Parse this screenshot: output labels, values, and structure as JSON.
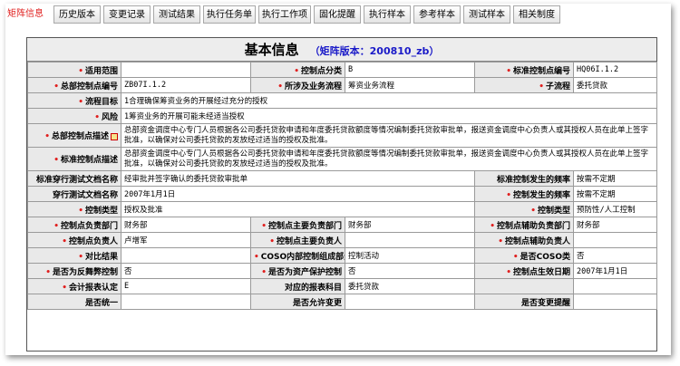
{
  "tabs": [
    "矩阵信息",
    "历史版本",
    "变更记录",
    "测试结果",
    "执行任务单",
    "执行工作项",
    "固化提醒",
    "执行样本",
    "参考样本",
    "测试样本",
    "相关制度"
  ],
  "title": "基本信息",
  "matrix_version": "（矩阵版本：200810_zb）",
  "fields": {
    "applicable_scope": {
      "label": "适用范围",
      "value": ""
    },
    "control_category": {
      "label": "控制点分类",
      "value": "B"
    },
    "std_control_code": {
      "label": "标准控制点编号",
      "value": "HQ06I.1.2"
    },
    "hq_control_code": {
      "label": "总部控制点编号",
      "value": "ZB07I.1.2"
    },
    "business_process": {
      "label": "所涉及业务流程",
      "value": "筹资业务流程"
    },
    "sub_process": {
      "label": "子流程",
      "value": "委托贷款"
    },
    "process_goal": {
      "label": "流程目标",
      "value": "1合理确保筹资业务的开展经过充分的授权"
    },
    "risk": {
      "label": "风险",
      "value": "1筹资业务的开展可能未经适当授权"
    },
    "hq_control_desc": {
      "label": "总部控制点描述",
      "value": "总部资金调度中心专门人员根据各公司委托贷款申请和年度委托贷款额度等情况编制委托贷款审批单，报送资金调度中心负责人或其授权人员在此单上签字批准，以确保对公司委托贷款的发放经过适当的授权及批准。"
    },
    "std_control_desc": {
      "label": "标准控制点描述",
      "value": "总部资金调度中心专门人员根据各公司委托贷款申请和年度委托贷款额度等情况编制委托贷款审批单，报送资金调度中心负责人或其授权人员在此单上签字批准，以确保对公司委托贷款的发放经过适当的授权及批准。"
    },
    "std_walkthrough_doc": {
      "label": "标准穿行测试文档名称",
      "value": "经审批并签字确认的委托贷款审批单"
    },
    "std_control_freq": {
      "label": "标准控制发生的频率",
      "value": "按需不定期"
    },
    "walkthrough_doc": {
      "label": "穿行测试文档名称",
      "value": "2007年1月1日"
    },
    "control_freq": {
      "label": "控制发生的频率",
      "value": "按需不定期"
    },
    "control_type": {
      "label": "控制类型",
      "value": "授权及批准"
    },
    "control_mode": {
      "label": "控制类型",
      "value": "预防性/人工控制"
    },
    "responsible_dept": {
      "label": "控制点负责部门",
      "value": "财务部"
    },
    "main_resp_dept": {
      "label": "控制点主要负责部门",
      "value": "财务部"
    },
    "assist_resp_dept": {
      "label": "控制点辅助负责部门",
      "value": "财务部"
    },
    "responsible_person": {
      "label": "控制点负责人",
      "value": "卢增军"
    },
    "main_resp_person": {
      "label": "控制点主要负责人",
      "value": ""
    },
    "assist_resp_person": {
      "label": "控制点辅助负责人",
      "value": ""
    },
    "comparison_result": {
      "label": "对比结果",
      "value": ""
    },
    "coso_component": {
      "label": "COSO内部控制组成部分",
      "value": "控制活动"
    },
    "is_coso_class": {
      "label": "是否COSO类",
      "value": "否"
    },
    "anti_fraud": {
      "label": "是否为反舞弊控制",
      "value": "否"
    },
    "asset_protect": {
      "label": "是否为资产保护控制",
      "value": "否"
    },
    "effective_date": {
      "label": "控制点生效日期",
      "value": "2007年1月1日"
    },
    "statement_assertion": {
      "label": "会计报表认定",
      "value": "E"
    },
    "statement_subject": {
      "label": "对应的报表科目",
      "value": "委托贷款"
    },
    "is_unified": {
      "label": "是否统一",
      "value": ""
    },
    "allow_change": {
      "label": "是否允许变更",
      "value": ""
    },
    "change_reminder": {
      "label": "是否变更提醒",
      "value": ""
    }
  }
}
